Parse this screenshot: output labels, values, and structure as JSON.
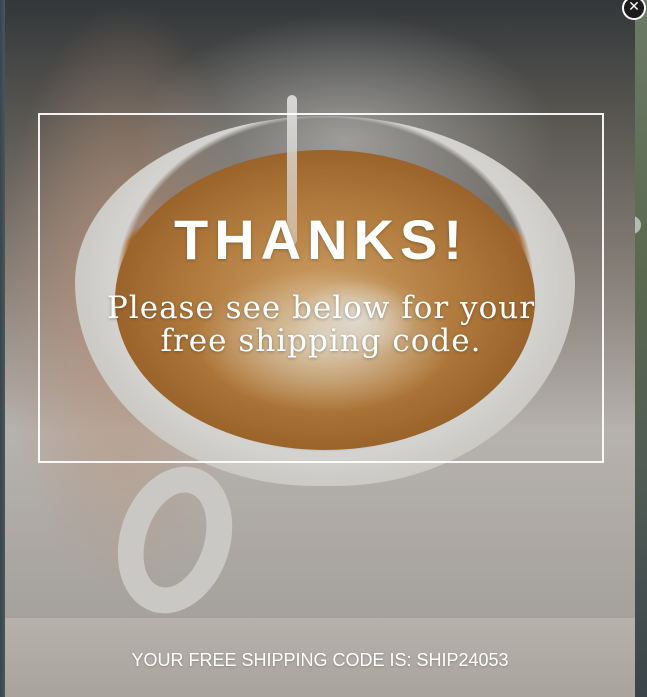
{
  "popup": {
    "headline": "THANKS!",
    "message_line1": "Please see below for your",
    "message_line2": "free shipping code.",
    "code_text": "YOUR FREE SHIPPING CODE IS: SHIP24053",
    "close_icon": "close-icon",
    "close_glyph": "✕"
  },
  "colors": {
    "text": "#ffffff",
    "frame_border": "#ffffff",
    "close_button_bg": "#1c1c1c"
  }
}
